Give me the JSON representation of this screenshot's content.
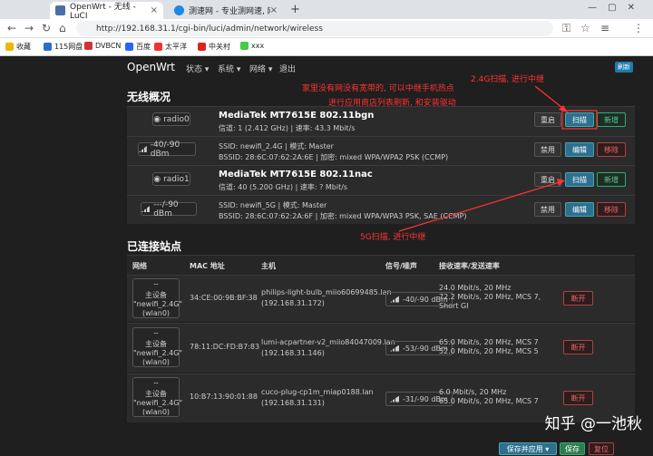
{
  "browser": {
    "tabs": [
      {
        "label": "OpenWrt - 无线 - LuCI"
      },
      {
        "label": "测速网 - 专业测网速, 网速测"
      }
    ],
    "new_tab": "+",
    "url": "http://192.168.31.1/cgi-bin/luci/admin/network/wireless",
    "bookmarks": [
      "收藏",
      "115网盘",
      "DVBCN",
      "百度",
      "太平洋",
      "中关村",
      "xxx"
    ]
  },
  "header": {
    "logo": "OpenWrt",
    "menu": [
      "状态 ▾",
      "系统 ▾",
      "网络 ▾",
      "退出"
    ],
    "refresh_badge": "刷新"
  },
  "overview": {
    "title": "无线概况",
    "radios": [
      {
        "device": "radio0",
        "name": "MediaTek MT7615E 802.11bgn",
        "info": "信道: 1 (2.412 GHz) | 速率: 43.3 Mbit/s",
        "buttons": {
          "restart": "重启",
          "scan": "扫描",
          "add": "新增"
        },
        "network": {
          "signal": "-40/-90 dBm",
          "line1": "SSID: newifi_2.4G | 模式: Master",
          "line2": "BSSID: 28:6C:07:62:2A:6E | 加密: mixed WPA/WPA2 PSK (CCMP)",
          "buttons": {
            "disable": "禁用",
            "edit": "编辑",
            "remove": "移除"
          }
        }
      },
      {
        "device": "radio1",
        "name": "MediaTek MT7615E 802.11nac",
        "info": "信道: 40 (5.200 GHz) | 速率: ? Mbit/s",
        "buttons": {
          "restart": "重启",
          "scan": "扫描",
          "add": "新增"
        },
        "network": {
          "signal": "---/-90 dBm",
          "line1": "SSID: newifi_5G | 模式: Master",
          "line2": "BSSID: 28:6C:07:62:2A:6F | 加密: mixed WPA/WPA3 PSK, SAE (CCMP)",
          "buttons": {
            "disable": "禁用",
            "edit": "编辑",
            "remove": "移除"
          }
        }
      }
    ]
  },
  "annotations": {
    "a1": "家里没有网没有宽带的, 可以中继手机热点",
    "a2": "进行应用商店列表刷新, 和安装驱动",
    "a3": "2.4G扫描, 进行中继",
    "a4": "5G扫描, 进行中继"
  },
  "stations": {
    "title": "已连接站点",
    "headers": [
      "网络",
      "MAC 地址",
      "主机",
      "信号/噪声",
      "接收速率/发送速率"
    ],
    "rows": [
      {
        "iface": [
          "主设备",
          "\"newifi_2.4G\"",
          "(wlan0)"
        ],
        "mac": "34:CE:00:9B:BF:38",
        "host1": "philips-light-bulb_miio60699485.lan",
        "host2": "(192.168.31.172)",
        "signal": "-40/-90 dBm",
        "rate": [
          "24.0 Mbit/s, 20 MHz",
          "72.2 Mbit/s, 20 MHz, MCS 7,",
          "Short GI"
        ],
        "action": "断开"
      },
      {
        "iface": [
          "主设备",
          "\"newifi_2.4G\"",
          "(wlan0)"
        ],
        "mac": "78:11:DC:FD:B7:83",
        "host1": "lumi-acpartner-v2_miio84047009.lan",
        "host2": "(192.168.31.146)",
        "signal": "-53/-90 dBm",
        "rate": [
          "65.0 Mbit/s, 20 MHz, MCS 7",
          "52.0 Mbit/s, 20 MHz, MCS 5"
        ],
        "action": "断开"
      },
      {
        "iface": [
          "主设备",
          "\"newifi_2.4G\"",
          "(wlan0)"
        ],
        "mac": "10:B7:13:90:01:88",
        "host1": "cuco-plug-cp1m_miap0188.lan",
        "host2": "(192.168.31.131)",
        "signal": "-31/-90 dBm",
        "rate": [
          "6.0 Mbit/s, 20 MHz",
          "65.0 Mbit/s, 20 MHz, MCS 7"
        ],
        "action": "断开"
      }
    ]
  },
  "footer": {
    "save_apply": "保存并应用 ▾",
    "save": "保存",
    "reset": "复位"
  },
  "watermark": "知乎 @一池秋"
}
